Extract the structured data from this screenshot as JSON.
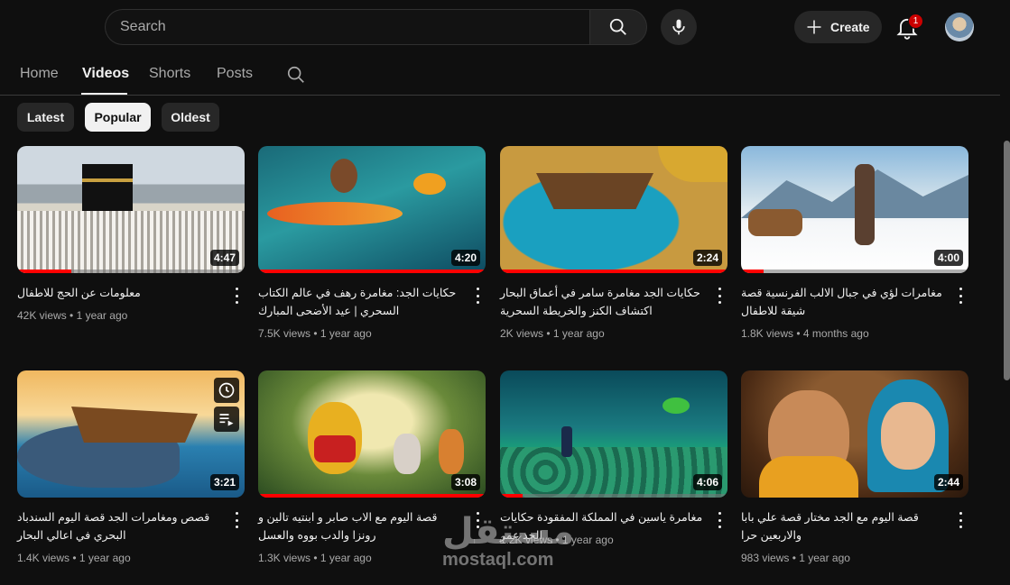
{
  "header": {
    "search_placeholder": "Search",
    "create_label": "Create",
    "notification_count": "1"
  },
  "tabs": [
    {
      "label": "Home"
    },
    {
      "label": "Videos"
    },
    {
      "label": "Shorts"
    },
    {
      "label": "Posts"
    }
  ],
  "chips": [
    {
      "label": "Latest"
    },
    {
      "label": "Popular"
    },
    {
      "label": "Oldest"
    }
  ],
  "videos": [
    {
      "title": "معلومات عن الحج للاطفال",
      "views": "42K views",
      "age": "1 year ago",
      "duration": "4:47",
      "progress": 0.24
    },
    {
      "title": "حكايات الجد: مغامرة رهف في عالم الكتاب السحري | عيد الأضحى المبارك",
      "views": "7.5K views",
      "age": "1 year ago",
      "duration": "4:20",
      "progress": 1.0
    },
    {
      "title": "حكايات الجد مغامرة سامر في أعماق البحار اكتشاف الكنز والخريطة السحرية",
      "views": "2K views",
      "age": "1 year ago",
      "duration": "2:24",
      "progress": 1.0
    },
    {
      "title": "مغامرات لؤي في جبال الالب الفرنسية قصة شيقة للاطفال",
      "views": "1.8K views",
      "age": "4 months ago",
      "duration": "4:00",
      "progress": 0.1
    },
    {
      "title": "قصص ومغامرات الجد قصة اليوم السندباد البحري في اعالي البحار",
      "views": "1.4K views",
      "age": "1 year ago",
      "duration": "3:21",
      "progress": 0
    },
    {
      "title": "قصة اليوم مع الاب صابر و ابنتيه تالين و رونزا والدب بووه والعسل",
      "views": "1.3K views",
      "age": "1 year ago",
      "duration": "3:08",
      "progress": 1.0
    },
    {
      "title": "مغامرة ياسين في المملكة المفقودة حكايات الجد عمر",
      "views": "1.2K views",
      "age": "1 year ago",
      "duration": "4:06",
      "progress": 0.1
    },
    {
      "title": "قصة اليوم مع الجد مختار قصة علي بابا والاربعين حرا",
      "views": "983 views",
      "age": "1 year ago",
      "duration": "2:44",
      "progress": 0
    }
  ],
  "watermark": {
    "arabic": "مستقل",
    "latin": "mostaql.com"
  },
  "colors": {
    "accent": "#ff0000",
    "background": "#0f0f0f",
    "badge": "#cc0000"
  }
}
